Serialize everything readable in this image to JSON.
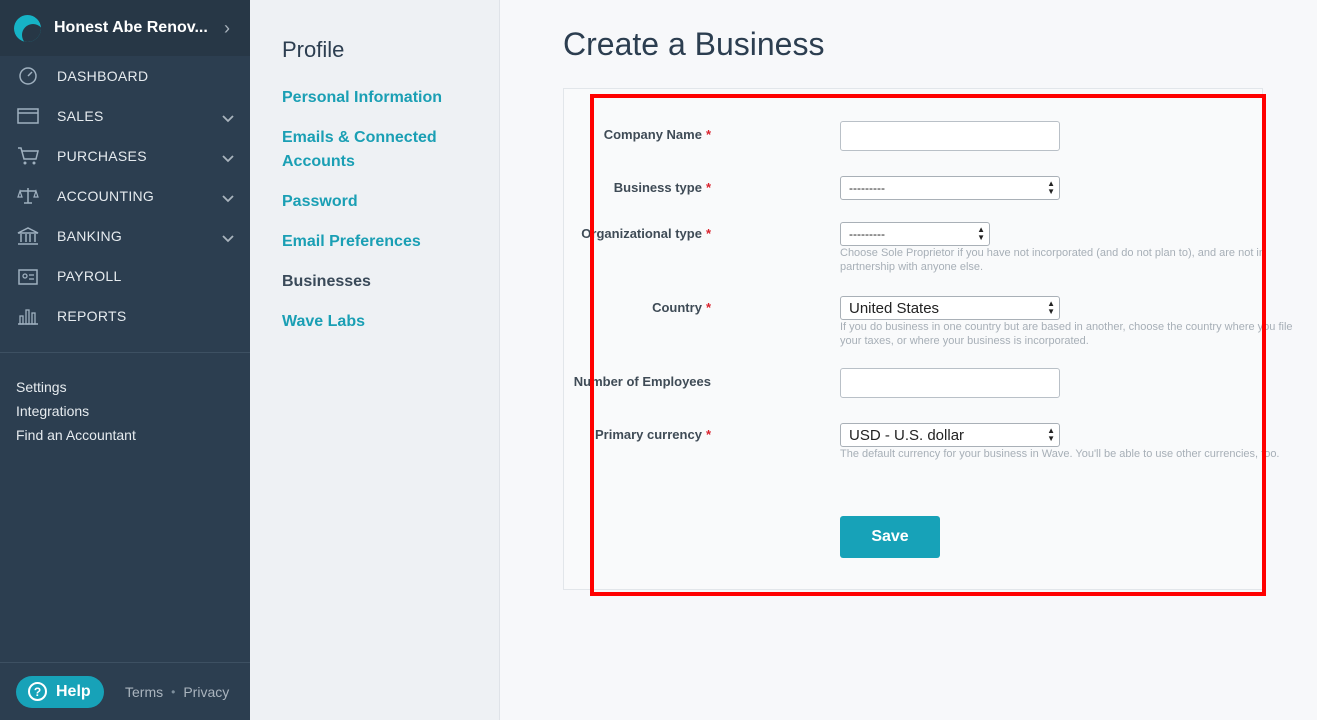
{
  "sidebar": {
    "business_name": "Honest Abe Renov...",
    "nav": [
      {
        "label": "DASHBOARD",
        "icon": "dashboard-icon"
      },
      {
        "label": "SALES",
        "icon": "sales-icon"
      },
      {
        "label": "PURCHASES",
        "icon": "cart-icon"
      },
      {
        "label": "ACCOUNTING",
        "icon": "scale-icon"
      },
      {
        "label": "BANKING",
        "icon": "bank-icon"
      },
      {
        "label": "PAYROLL",
        "icon": "payroll-icon"
      },
      {
        "label": "REPORTS",
        "icon": "reports-icon"
      }
    ],
    "links": [
      "Settings",
      "Integrations",
      "Find an Accountant"
    ],
    "footer": {
      "help": "Help",
      "terms": "Terms",
      "privacy": "Privacy"
    }
  },
  "profile": {
    "title": "Profile",
    "links": [
      "Personal Information",
      "Emails & Connected Accounts",
      "Password",
      "Email Preferences",
      "Businesses",
      "Wave Labs"
    ],
    "active": "Businesses"
  },
  "main": {
    "title": "Create a Business",
    "form": {
      "company_name_label": "Company Name",
      "company_name_value": "",
      "business_type_label": "Business type",
      "business_type_value": "---------",
      "org_type_label": "Organizational type",
      "org_type_value": "---------",
      "org_type_hint": "Choose Sole Proprietor if you have not incorporated (and do not plan to), and are not in partnership with anyone else.",
      "country_label": "Country",
      "country_value": "United States",
      "country_hint": "If you do business in one country but are based in another, choose the country where you file your taxes, or where your business is incorporated.",
      "employees_label": "Number of Employees",
      "employees_value": "",
      "currency_label": "Primary currency",
      "currency_value": "USD - U.S. dollar",
      "currency_hint": "The default currency for your business in Wave. You'll be able to use other currencies, too.",
      "save_label": "Save"
    }
  },
  "colors": {
    "sidebar": "#2c3e50",
    "accent": "#17a2b8",
    "highlight": "#ff0000",
    "required": "#d9232d"
  }
}
